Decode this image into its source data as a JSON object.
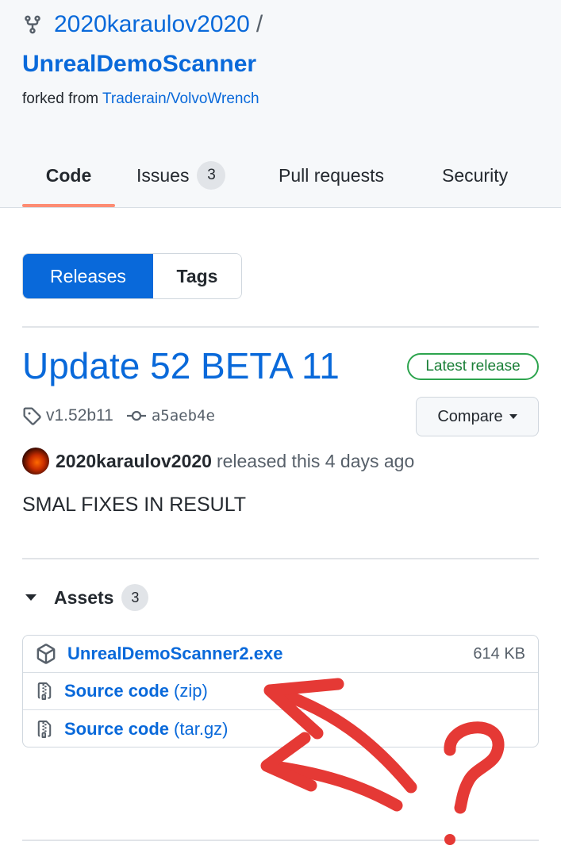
{
  "repo": {
    "owner": "2020karaulov2020",
    "separator": "/",
    "name": "UnrealDemoScanner",
    "forked_prefix": "forked from",
    "forked_source": "Traderain/VolvoWrench"
  },
  "tabs": [
    {
      "label": "Code",
      "active": true
    },
    {
      "label": "Issues",
      "count": "3"
    },
    {
      "label": "Pull requests"
    },
    {
      "label": "Security"
    }
  ],
  "segment": {
    "releases": "Releases",
    "tags": "Tags"
  },
  "release": {
    "title": "Update 52 BETA 11",
    "badge": "Latest release",
    "tag": "v1.52b11",
    "commit": "a5aeb4e",
    "compare_label": "Compare",
    "author": "2020karaulov2020",
    "released_text": "released this 4 days ago",
    "body": "SMAL FIXES IN RESULT"
  },
  "assets": {
    "label": "Assets",
    "count": "3",
    "items": [
      {
        "name": "UnrealDemoScanner2.exe",
        "suffix": "",
        "size": "614 KB",
        "icon": "package-icon"
      },
      {
        "name": "Source code",
        "suffix": "(zip)",
        "size": "",
        "icon": "file-zip-icon"
      },
      {
        "name": "Source code",
        "suffix": "(tar.gz)",
        "size": "",
        "icon": "file-zip-icon"
      }
    ]
  },
  "colors": {
    "link": "#0969da",
    "accent_underline": "#fd8c73",
    "success": "#1a7f37",
    "annotation": "#e53935"
  }
}
